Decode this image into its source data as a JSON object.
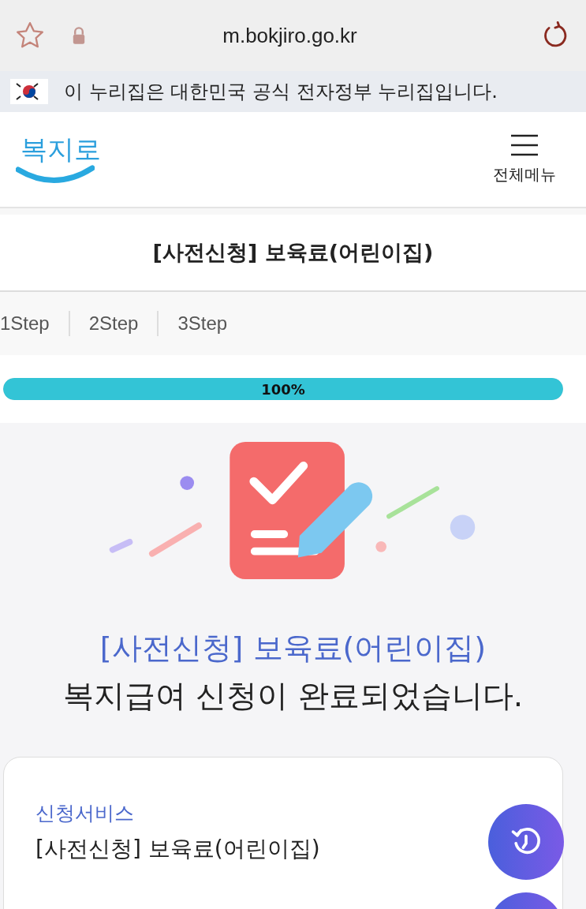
{
  "browser": {
    "url": "m.bokjiro.go.kr"
  },
  "gov_banner": {
    "text": "이 누리집은 대한민국 공식 전자정부 누리집입니다."
  },
  "header": {
    "logo": "복지로",
    "menu_label": "전체메뉴"
  },
  "page_title": "[사전신청] 보육료(어린이집)",
  "steps": [
    "1Step",
    "2Step",
    "3Step"
  ],
  "progress": {
    "level": 1,
    "label": "100%"
  },
  "result": {
    "service_name": "[사전신청] 보육료(어린이집)",
    "message": "복지급여 신청이 완료되었습니다."
  },
  "card": {
    "label": "신청서비스",
    "value": "[사전신청] 보육료(어린이집)"
  }
}
